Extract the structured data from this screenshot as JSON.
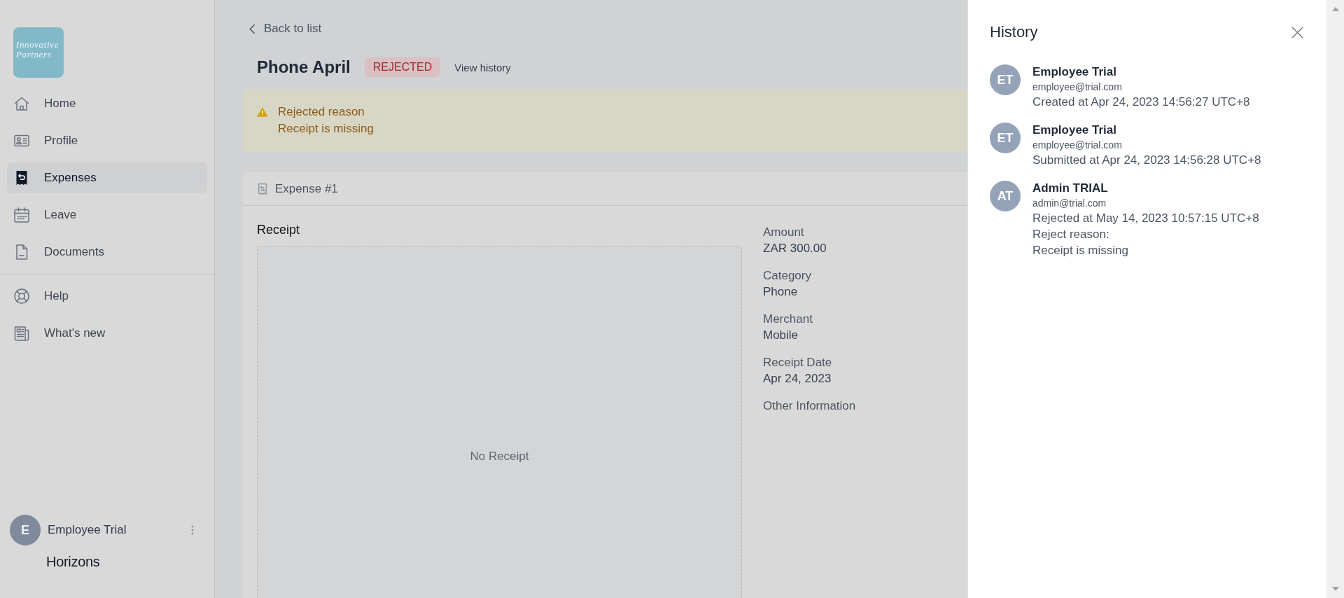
{
  "sidebar": {
    "logo": "Innovative Partners",
    "nav": [
      {
        "label": "Home",
        "selected": false
      },
      {
        "label": "Profile",
        "selected": false
      },
      {
        "label": "Expenses",
        "selected": true
      },
      {
        "label": "Leave",
        "selected": false
      },
      {
        "label": "Documents",
        "selected": false
      }
    ],
    "secondary_nav": [
      {
        "label": "Help",
        "selected": false
      },
      {
        "label": "What's new",
        "selected": false
      }
    ],
    "user": {
      "initial": "E",
      "name": "Employee Trial"
    },
    "brand": "Horizons"
  },
  "main": {
    "back_link": "Back to list",
    "title": "Phone April",
    "status": {
      "label": "REJECTED",
      "kind": "rejected"
    },
    "history_link": "View history",
    "alert": {
      "title": "Rejected reason",
      "message": "Receipt is missing"
    },
    "expense": {
      "title": "Expense #1",
      "receipt_label": "Receipt",
      "receipt_empty_text": "No Receipt",
      "fields": [
        {
          "label": "Amount",
          "value": "ZAR 300.00"
        },
        {
          "label": "Category",
          "value": "Phone"
        },
        {
          "label": "Merchant",
          "value": "Mobile"
        },
        {
          "label": "Receipt Date",
          "value": "Apr 24, 2023"
        },
        {
          "label": "Other Information"
        }
      ]
    }
  },
  "history": {
    "title": "History",
    "entries": [
      {
        "initials": "ET",
        "name": "Employee Trial",
        "email": "employee@trial.com",
        "details": [
          "Created at Apr 24, 2023 14:56:27 UTC+8"
        ]
      },
      {
        "initials": "ET",
        "name": "Employee Trial",
        "email": "employee@trial.com",
        "details": [
          "Submitted at Apr 24, 2023 14:56:28 UTC+8"
        ]
      },
      {
        "initials": "AT",
        "name": "Admin TRIAL",
        "email": "admin@trial.com",
        "details": [
          "Rejected at May 14, 2023 10:57:15 UTC+8",
          "Reject reason:",
          "Receipt is missing"
        ]
      }
    ]
  }
}
